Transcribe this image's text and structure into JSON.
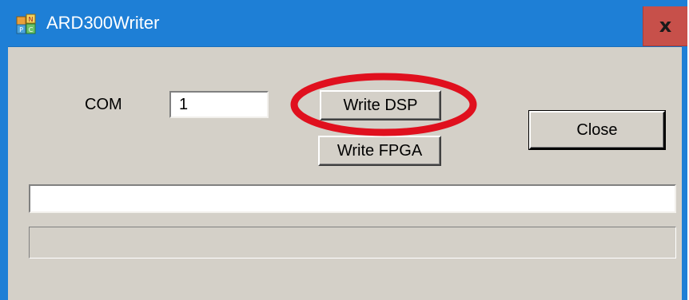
{
  "window": {
    "title": "ARD300Writer",
    "icon": "app-icon",
    "close_glyph": "x"
  },
  "form": {
    "com_label": "COM",
    "com_value": "1",
    "write_dsp_label": "Write DSP",
    "write_fpga_label": "Write FPGA",
    "close_label": "Close",
    "status_text": "",
    "progress": 0
  },
  "annotation": {
    "highlight_target": "Write DSP",
    "highlight_color": "#e0101e"
  },
  "colors": {
    "title_bar": "#1e7fd6",
    "close_button": "#c7504a",
    "dialog_face": "#d4d0c8"
  }
}
